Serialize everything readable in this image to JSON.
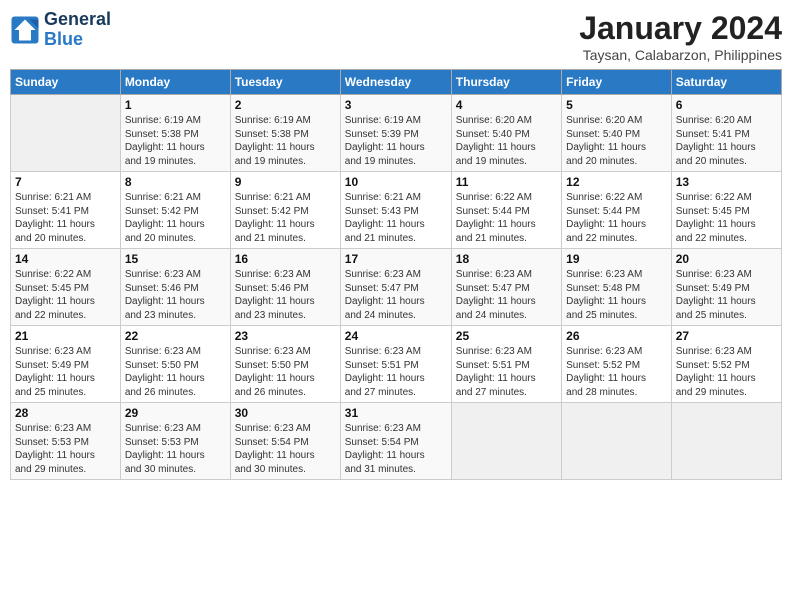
{
  "logo": {
    "line1": "General",
    "line2": "Blue"
  },
  "title": "January 2024",
  "subtitle": "Taysan, Calabarzon, Philippines",
  "days_header": [
    "Sunday",
    "Monday",
    "Tuesday",
    "Wednesday",
    "Thursday",
    "Friday",
    "Saturday"
  ],
  "weeks": [
    [
      {
        "day": "",
        "info": ""
      },
      {
        "day": "1",
        "info": "Sunrise: 6:19 AM\nSunset: 5:38 PM\nDaylight: 11 hours\nand 19 minutes."
      },
      {
        "day": "2",
        "info": "Sunrise: 6:19 AM\nSunset: 5:38 PM\nDaylight: 11 hours\nand 19 minutes."
      },
      {
        "day": "3",
        "info": "Sunrise: 6:19 AM\nSunset: 5:39 PM\nDaylight: 11 hours\nand 19 minutes."
      },
      {
        "day": "4",
        "info": "Sunrise: 6:20 AM\nSunset: 5:40 PM\nDaylight: 11 hours\nand 19 minutes."
      },
      {
        "day": "5",
        "info": "Sunrise: 6:20 AM\nSunset: 5:40 PM\nDaylight: 11 hours\nand 20 minutes."
      },
      {
        "day": "6",
        "info": "Sunrise: 6:20 AM\nSunset: 5:41 PM\nDaylight: 11 hours\nand 20 minutes."
      }
    ],
    [
      {
        "day": "7",
        "info": "Sunrise: 6:21 AM\nSunset: 5:41 PM\nDaylight: 11 hours\nand 20 minutes."
      },
      {
        "day": "8",
        "info": "Sunrise: 6:21 AM\nSunset: 5:42 PM\nDaylight: 11 hours\nand 20 minutes."
      },
      {
        "day": "9",
        "info": "Sunrise: 6:21 AM\nSunset: 5:42 PM\nDaylight: 11 hours\nand 21 minutes."
      },
      {
        "day": "10",
        "info": "Sunrise: 6:21 AM\nSunset: 5:43 PM\nDaylight: 11 hours\nand 21 minutes."
      },
      {
        "day": "11",
        "info": "Sunrise: 6:22 AM\nSunset: 5:44 PM\nDaylight: 11 hours\nand 21 minutes."
      },
      {
        "day": "12",
        "info": "Sunrise: 6:22 AM\nSunset: 5:44 PM\nDaylight: 11 hours\nand 22 minutes."
      },
      {
        "day": "13",
        "info": "Sunrise: 6:22 AM\nSunset: 5:45 PM\nDaylight: 11 hours\nand 22 minutes."
      }
    ],
    [
      {
        "day": "14",
        "info": "Sunrise: 6:22 AM\nSunset: 5:45 PM\nDaylight: 11 hours\nand 22 minutes."
      },
      {
        "day": "15",
        "info": "Sunrise: 6:23 AM\nSunset: 5:46 PM\nDaylight: 11 hours\nand 23 minutes."
      },
      {
        "day": "16",
        "info": "Sunrise: 6:23 AM\nSunset: 5:46 PM\nDaylight: 11 hours\nand 23 minutes."
      },
      {
        "day": "17",
        "info": "Sunrise: 6:23 AM\nSunset: 5:47 PM\nDaylight: 11 hours\nand 24 minutes."
      },
      {
        "day": "18",
        "info": "Sunrise: 6:23 AM\nSunset: 5:47 PM\nDaylight: 11 hours\nand 24 minutes."
      },
      {
        "day": "19",
        "info": "Sunrise: 6:23 AM\nSunset: 5:48 PM\nDaylight: 11 hours\nand 25 minutes."
      },
      {
        "day": "20",
        "info": "Sunrise: 6:23 AM\nSunset: 5:49 PM\nDaylight: 11 hours\nand 25 minutes."
      }
    ],
    [
      {
        "day": "21",
        "info": "Sunrise: 6:23 AM\nSunset: 5:49 PM\nDaylight: 11 hours\nand 25 minutes."
      },
      {
        "day": "22",
        "info": "Sunrise: 6:23 AM\nSunset: 5:50 PM\nDaylight: 11 hours\nand 26 minutes."
      },
      {
        "day": "23",
        "info": "Sunrise: 6:23 AM\nSunset: 5:50 PM\nDaylight: 11 hours\nand 26 minutes."
      },
      {
        "day": "24",
        "info": "Sunrise: 6:23 AM\nSunset: 5:51 PM\nDaylight: 11 hours\nand 27 minutes."
      },
      {
        "day": "25",
        "info": "Sunrise: 6:23 AM\nSunset: 5:51 PM\nDaylight: 11 hours\nand 27 minutes."
      },
      {
        "day": "26",
        "info": "Sunrise: 6:23 AM\nSunset: 5:52 PM\nDaylight: 11 hours\nand 28 minutes."
      },
      {
        "day": "27",
        "info": "Sunrise: 6:23 AM\nSunset: 5:52 PM\nDaylight: 11 hours\nand 29 minutes."
      }
    ],
    [
      {
        "day": "28",
        "info": "Sunrise: 6:23 AM\nSunset: 5:53 PM\nDaylight: 11 hours\nand 29 minutes."
      },
      {
        "day": "29",
        "info": "Sunrise: 6:23 AM\nSunset: 5:53 PM\nDaylight: 11 hours\nand 30 minutes."
      },
      {
        "day": "30",
        "info": "Sunrise: 6:23 AM\nSunset: 5:54 PM\nDaylight: 11 hours\nand 30 minutes."
      },
      {
        "day": "31",
        "info": "Sunrise: 6:23 AM\nSunset: 5:54 PM\nDaylight: 11 hours\nand 31 minutes."
      },
      {
        "day": "",
        "info": ""
      },
      {
        "day": "",
        "info": ""
      },
      {
        "day": "",
        "info": ""
      }
    ]
  ]
}
